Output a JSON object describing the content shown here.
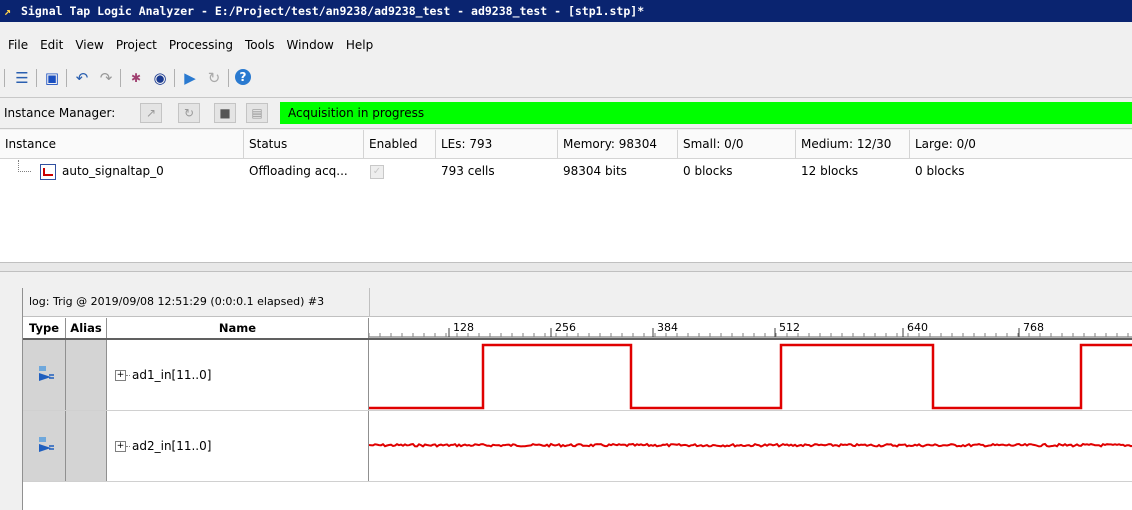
{
  "window": {
    "title": "Signal Tap Logic Analyzer - E:/Project/test/an9238/ad9238_test - ad9238_test - [stp1.stp]*"
  },
  "menu": [
    "File",
    "Edit",
    "View",
    "Project",
    "Processing",
    "Tools",
    "Window",
    "Help"
  ],
  "toolbar": {
    "icons": [
      "setup-icon",
      "save-icon",
      "undo-icon",
      "redo-icon",
      "node-finder-icon",
      "find-icon",
      "run-analysis-icon",
      "autorun-icon",
      "help-icon"
    ]
  },
  "instance_manager": {
    "label": "Instance Manager:",
    "status": "Acquisition in progress",
    "status_color": "#00ff00"
  },
  "instance_table": {
    "headers": [
      "Instance",
      "Status",
      "Enabled",
      "LEs: 793",
      "Memory: 98304",
      "Small: 0/0",
      "Medium: 12/30",
      "Large: 0/0"
    ],
    "rows": [
      {
        "instance": "auto_signaltap_0",
        "status": "Offloading acq...",
        "enabled": true,
        "les": "793 cells",
        "memory": "98304 bits",
        "small": "0 blocks",
        "medium": "12 blocks",
        "large": "0 blocks"
      }
    ]
  },
  "log": {
    "title": "log: Trig @ 2019/09/08 12:51:29 (0:0:0.1 elapsed) #3",
    "headers": {
      "type": "Type",
      "alias": "Alias",
      "name": "Name"
    },
    "timescale": [
      "128",
      "256",
      "384",
      "512",
      "640",
      "768"
    ],
    "signals": [
      {
        "name": "ad1_in[11..0]",
        "waveform": "square"
      },
      {
        "name": "ad2_in[11..0]",
        "waveform": "noise"
      }
    ],
    "wave_color": "#e00000"
  }
}
